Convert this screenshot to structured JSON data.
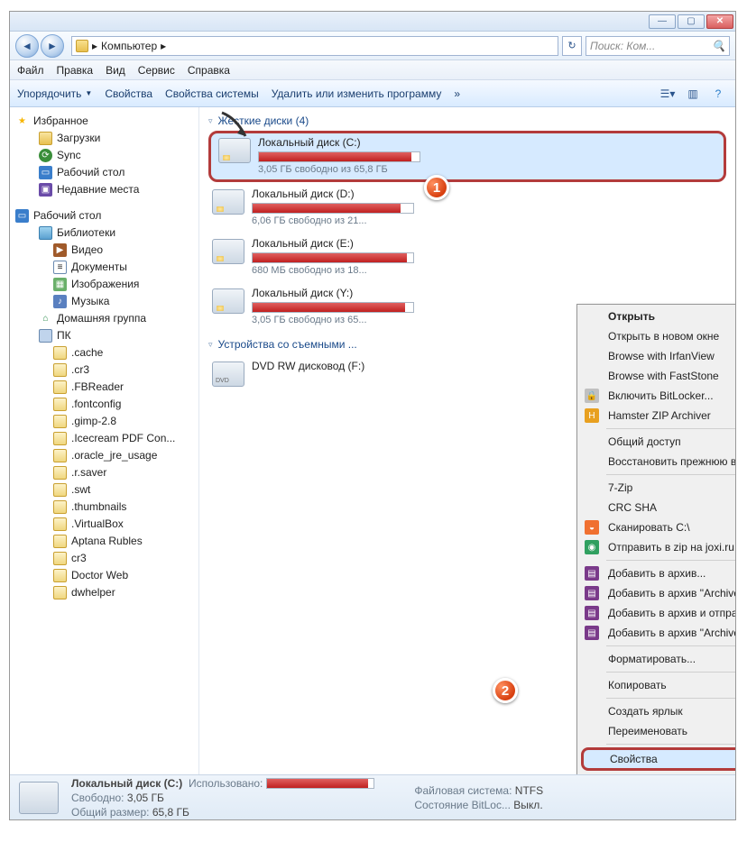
{
  "titlebar": {
    "min": "—",
    "max": "▢",
    "close": "✕"
  },
  "breadcrumb": {
    "node": "Компьютер",
    "sep": "▸",
    "search_placeholder": "Поиск: Ком..."
  },
  "menubar": {
    "file": "Файл",
    "edit": "Правка",
    "view": "Вид",
    "tools": "Сервис",
    "help": "Справка"
  },
  "toolbar": {
    "organize": "Упорядочить",
    "props": "Свойства",
    "sysprops": "Свойства системы",
    "uninstall": "Удалить или изменить программу",
    "more": "»"
  },
  "sidebar": {
    "favorites": "Избранное",
    "fav": {
      "downloads": "Загрузки",
      "sync": "Sync",
      "desktop": "Рабочий стол",
      "recent": "Недавние места"
    },
    "desktop_root": "Рабочий стол",
    "libraries": "Библиотеки",
    "lib": {
      "videos": "Видео",
      "docs": "Документы",
      "pics": "Изображения",
      "music": "Музыка"
    },
    "homegroup": "Домашняя группа",
    "pc": "ПК",
    "folders": [
      ".cache",
      ".cr3",
      ".FBReader",
      ".fontconfig",
      ".gimp-2.8",
      ".Icecream PDF Con...",
      ".oracle_jre_usage",
      ".r.saver",
      ".swt",
      ".thumbnails",
      ".VirtualBox",
      "Aptana Rubles",
      "cr3",
      "Doctor Web",
      "dwhelper"
    ]
  },
  "main": {
    "hdd_header": "Жесткие диски (4)",
    "removable_header": "Устройства со съемными ...",
    "drives": [
      {
        "name": "Локальный диск (C:)",
        "free": "3,05 ГБ свободно из 65,8 ГБ",
        "fill": 95,
        "sel": true
      },
      {
        "name": "Локальный диск (D:)",
        "free": "6,06 ГБ свободно из 21...",
        "fill": 92
      },
      {
        "name": "Локальный диск (E:)",
        "free": "680 МБ свободно из 18...",
        "fill": 96
      },
      {
        "name": "Локальный диск (Y:)",
        "free": "3,05 ГБ свободно из 65...",
        "fill": 95
      }
    ],
    "dvd": "DVD RW дисковод (F:)"
  },
  "ctx": {
    "open": "Открыть",
    "open_new": "Открыть в новом окне",
    "irfan": "Browse with IrfanView",
    "faststone": "Browse with FastStone",
    "bitlocker": "Включить BitLocker...",
    "hamster": "Hamster ZIP Archiver",
    "share": "Общий доступ",
    "restore": "Восстановить прежнюю версию",
    "sevenzip": "7-Zip",
    "crc": "CRC SHA",
    "scan": "Сканировать C:\\",
    "joxi": "Отправить в zip на joxi.ru",
    "add_archive": "Добавить в архив...",
    "add_rar": "Добавить в архив \"Archive.rar\"",
    "add_email": "Добавить в архив и отправить по e-mail...",
    "add_rar_email": "Добавить в архив \"Archive.rar\" и отправить по e-mail",
    "format": "Форматировать...",
    "copy": "Копировать",
    "shortcut": "Создать ярлык",
    "rename": "Переименовать",
    "properties": "Свойства"
  },
  "status": {
    "name": "Локальный диск (C:)",
    "used_l": "Использовано:",
    "free_l": "Свободно:",
    "free_v": "3,05 ГБ",
    "total_l": "Общий размер:",
    "total_v": "65,8 ГБ",
    "fs_l": "Файловая система:",
    "fs_v": "NTFS",
    "bl_l": "Состояние BitLoc...",
    "bl_v": "Выкл."
  },
  "badges": {
    "one": "1",
    "two": "2"
  }
}
